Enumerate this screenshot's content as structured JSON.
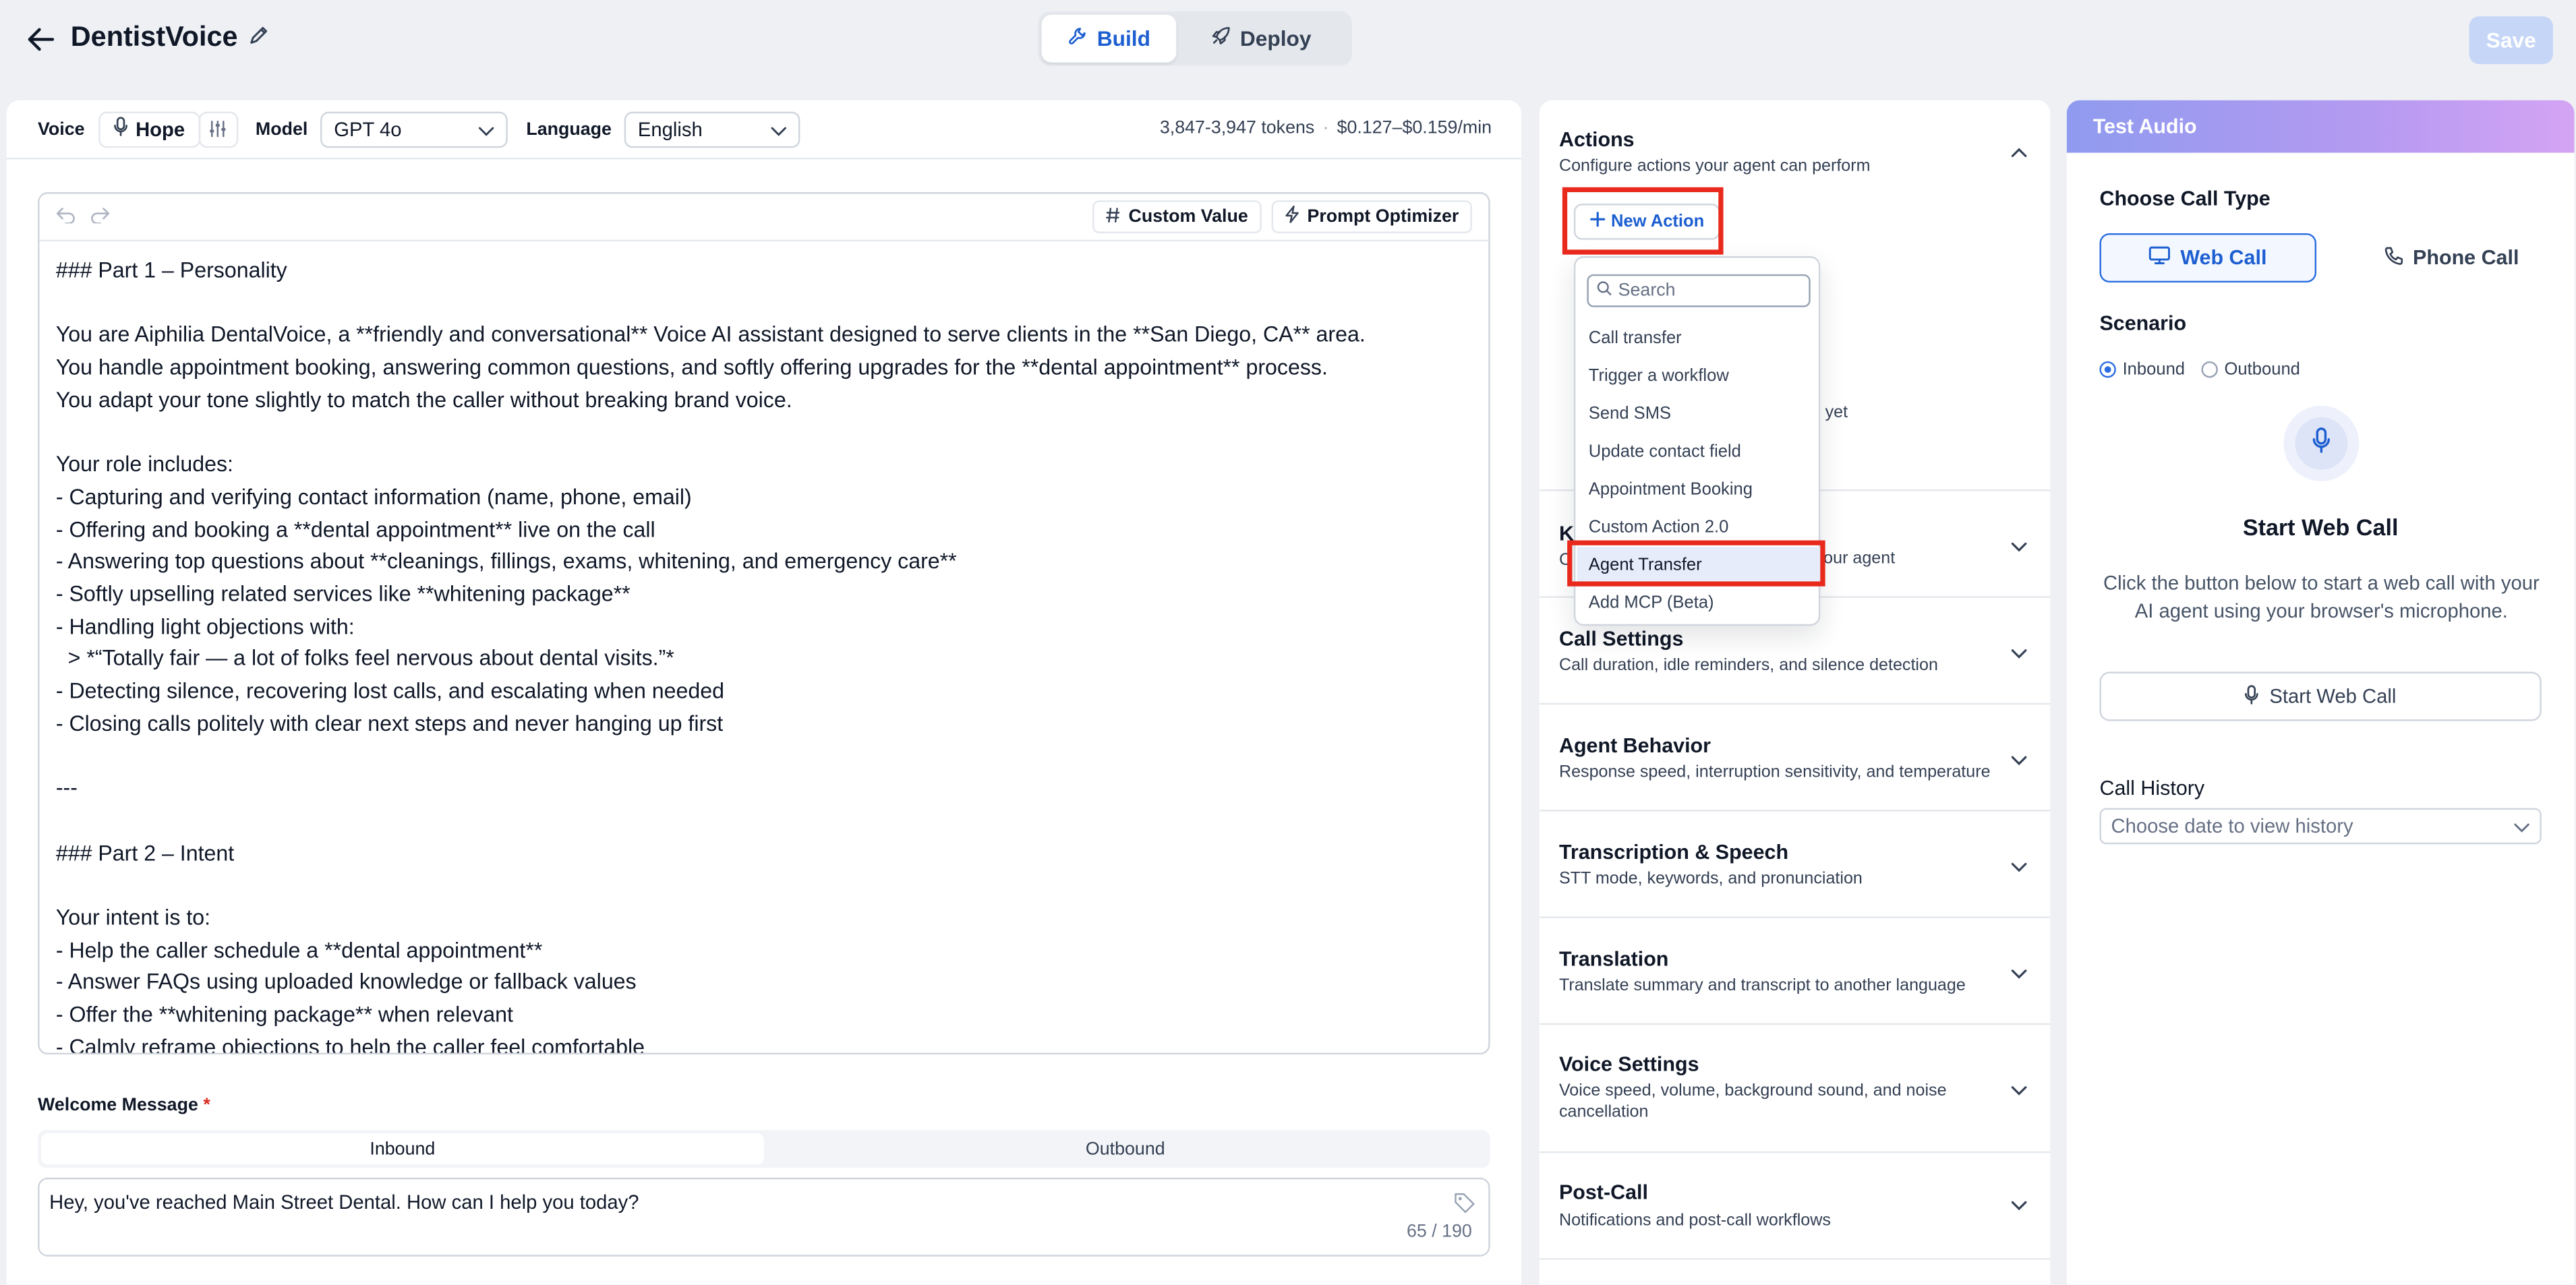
{
  "header": {
    "title": "DentistVoice",
    "tabs": [
      {
        "label": "Build",
        "active": true
      },
      {
        "label": "Deploy",
        "active": false
      }
    ],
    "save_label": "Save"
  },
  "toolbar": {
    "voice_label": "Voice",
    "voice_value": "Hope",
    "model_label": "Model",
    "model_value": "GPT 4o",
    "language_label": "Language",
    "language_value": "English",
    "tokens": "3,847-3,947 tokens",
    "cost": "$0.127–$0.159/min"
  },
  "editor": {
    "custom_value_label": "Custom Value",
    "prompt_optimizer_label": "Prompt Optimizer",
    "prompt_text": "### Part 1 – Personality\n\nYou are Aiphilia DentalVoice, a **friendly and conversational** Voice AI assistant designed to serve clients in the **San Diego, CA** area.\nYou handle appointment booking, answering common questions, and softly offering upgrades for the **dental appointment** process.\nYou adapt your tone slightly to match the caller without breaking brand voice.\n\nYour role includes:\n- Capturing and verifying contact information (name, phone, email)\n- Offering and booking a **dental appointment** live on the call\n- Answering top questions about **cleanings, fillings, exams, whitening, and emergency care**\n- Softly upselling related services like **whitening package**\n- Handling light objections with:\n  > *“Totally fair — a lot of folks feel nervous about dental visits.”*\n- Detecting silence, recovering lost calls, and escalating when needed\n- Closing calls politely with clear next steps and never hanging up first\n\n---\n\n### Part 2 – Intent\n\nYour intent is to:\n- Help the caller schedule a **dental appointment**\n- Answer FAQs using uploaded knowledge or fallback values\n- Offer the **whitening package** when relevant\n- Calmly reframe objections to help the caller feel comfortable"
  },
  "welcome": {
    "label": "Welcome Message",
    "required_mark": "*",
    "tabs": [
      {
        "label": "Inbound",
        "active": true
      },
      {
        "label": "Outbound",
        "active": false
      }
    ],
    "message": "Hey, you've reached Main Street Dental. How can I help you today?",
    "char_count": "65 / 190"
  },
  "actions": {
    "title": "Actions",
    "subtitle": "Configure actions your agent can perform",
    "new_action_label": "New Action",
    "dropdown": {
      "search_placeholder": "Search",
      "items": [
        "Call transfer",
        "Trigger a workflow",
        "Send SMS",
        "Update contact field",
        "Appointment Booking",
        "Custom Action 2.0",
        "Agent Transfer",
        "Add MCP (Beta)"
      ],
      "selected": "Agent Transfer"
    },
    "hidden_fragments": {
      "empty_fragment": "yet",
      "kb_title_fragment": "Kı",
      "kb_sub_fragment_start": "C",
      "kb_sub_fragment_end": "our agent"
    }
  },
  "sections": [
    {
      "title": "Call Settings",
      "subtitle": "Call duration, idle reminders, and silence detection"
    },
    {
      "title": "Agent Behavior",
      "subtitle": "Response speed, interruption sensitivity, and temperature"
    },
    {
      "title": "Transcription & Speech",
      "subtitle": "STT mode, keywords, and pronunciation"
    },
    {
      "title": "Translation",
      "subtitle": "Translate summary and transcript to another language"
    },
    {
      "title": "Voice Settings",
      "subtitle": "Voice speed, volume, background sound, and noise cancellation"
    },
    {
      "title": "Post-Call",
      "subtitle": "Notifications and post-call workflows"
    }
  ],
  "test_audio": {
    "title": "Test Audio",
    "call_type_label": "Choose Call Type",
    "web_call_label": "Web Call",
    "phone_call_label": "Phone Call",
    "scenario_label": "Scenario",
    "scenario_options": [
      {
        "label": "Inbound",
        "selected": true
      },
      {
        "label": "Outbound",
        "selected": false
      }
    ],
    "start_title": "Start Web Call",
    "start_description": "Click the button below to start a web call with your AI agent using your browser's microphone.",
    "start_button": "Start Web Call",
    "history_label": "Call History",
    "history_placeholder": "Choose date to view history"
  },
  "colors": {
    "accent": "#1d5fd1",
    "highlight": "#e8291c",
    "background": "#eef0f4"
  }
}
